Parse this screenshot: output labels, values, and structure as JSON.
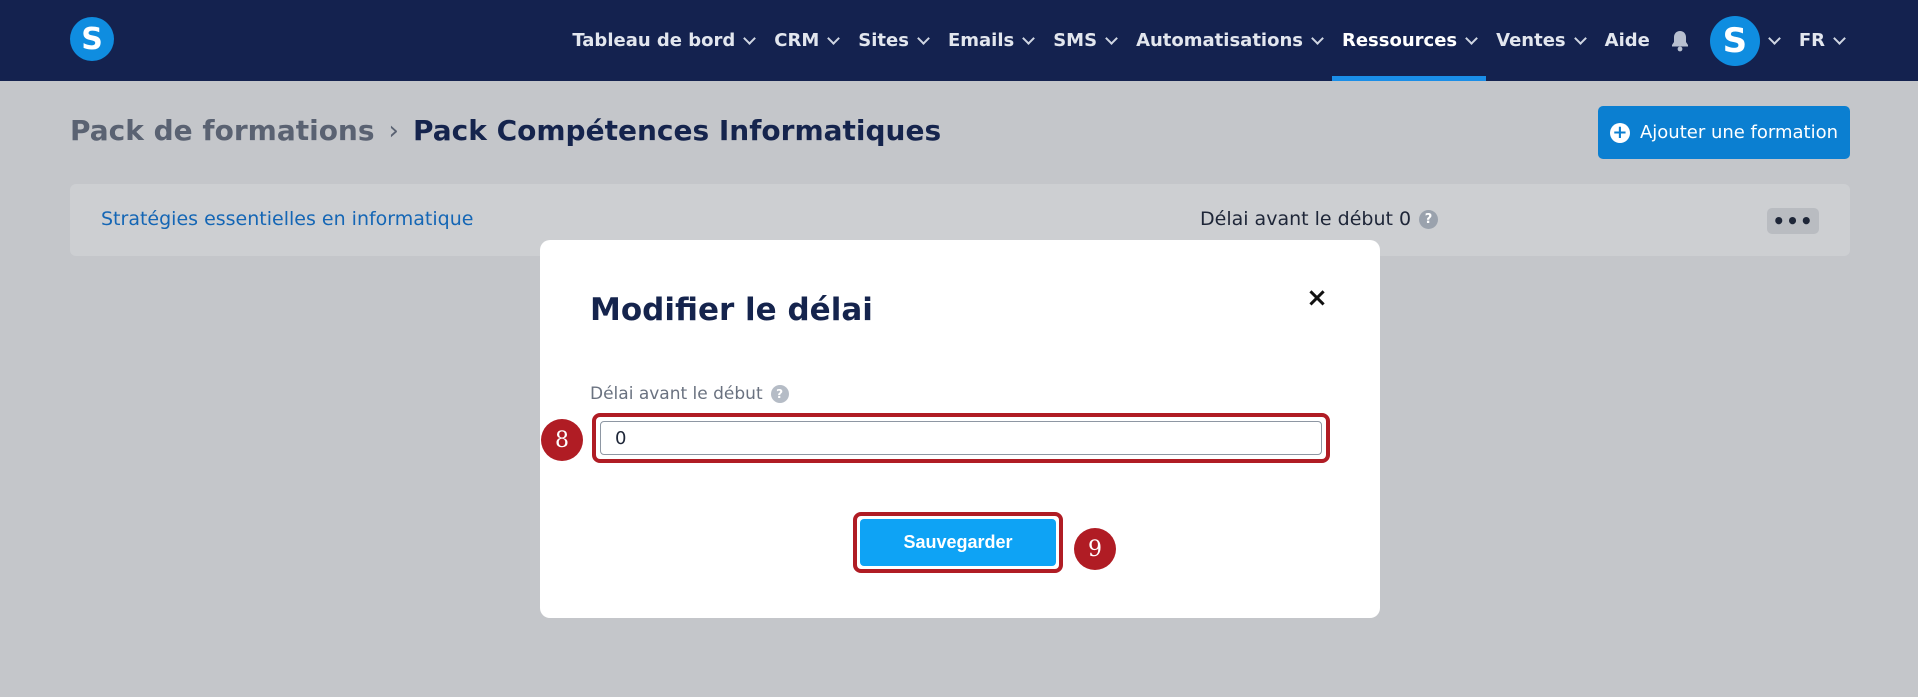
{
  "app": {
    "logo_letter": "S"
  },
  "nav": {
    "items": [
      {
        "label": "Tableau de bord",
        "chevron": true,
        "active": false
      },
      {
        "label": "CRM",
        "chevron": true,
        "active": false
      },
      {
        "label": "Sites",
        "chevron": true,
        "active": false
      },
      {
        "label": "Emails",
        "chevron": true,
        "active": false
      },
      {
        "label": "SMS",
        "chevron": true,
        "active": false
      },
      {
        "label": "Automatisations",
        "chevron": true,
        "active": false
      },
      {
        "label": "Ressources",
        "chevron": true,
        "active": true
      },
      {
        "label": "Ventes",
        "chevron": true,
        "active": false
      },
      {
        "label": "Aide",
        "chevron": false,
        "active": false
      }
    ],
    "avatar_letter": "S",
    "language": "FR",
    "active_color": "#1a8ee8"
  },
  "breadcrumb": {
    "parent": "Pack de formations",
    "separator": "›",
    "current": "Pack Compétences Informatiques"
  },
  "header": {
    "add_button_label": "Ajouter une formation"
  },
  "row": {
    "link": "Stratégies essentielles en informatique",
    "delay_label": "Délai avant le début 0",
    "help_glyph": "?",
    "menu_glyph": "•••"
  },
  "modal": {
    "title": "Modifier le délai",
    "close_glyph": "×",
    "field_label": "Délai avant le début",
    "field_value": "0",
    "save_label": "Sauvegarder"
  },
  "annotations": {
    "step_input": "8",
    "step_save": "9",
    "highlight_color": "#b01c24"
  }
}
